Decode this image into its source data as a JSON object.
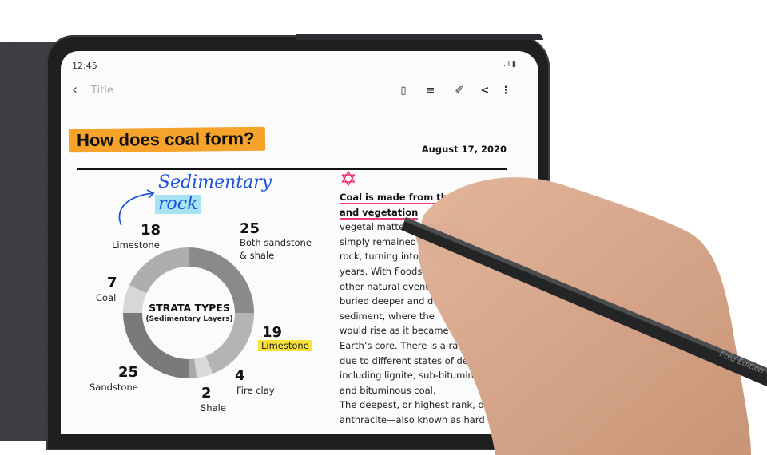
{
  "device": {
    "status_bar": {
      "time": "12:45",
      "signal_icon": "signal-icon",
      "battery_icon": "battery-icon"
    },
    "app_bar": {
      "back_icon": "chevron-left-icon",
      "title": "Title",
      "actions": [
        {
          "name": "book-view-icon",
          "glyph": "▯"
        },
        {
          "name": "note-icon",
          "glyph": "≡"
        },
        {
          "name": "attach-icon",
          "glyph": "✐"
        },
        {
          "name": "share-icon",
          "glyph": "<"
        },
        {
          "name": "more-icon",
          "glyph": "⋮"
        }
      ]
    }
  },
  "note": {
    "heading": "How does coal form?",
    "date": "August 17, 2020",
    "annotation_line1": "Sedimentary",
    "annotation_line2": "rock",
    "star_glyph": "✡",
    "body_bold_1": "Coal is made from the remai",
    "body_bold_2": "and vegetation",
    "body_lines": [
      "vegetal matte",
      "simply remained",
      "rock, turning into",
      "years. With floods,",
      "other natural event",
      "buried deeper and de",
      "sediment, where the",
      "would rise as it became",
      "Earth’s core. There is a ra",
      "due to different states of de",
      "including lignite, sub-bitumino",
      "and bituminous coal.",
      "The deepest, or highest rank, of coa",
      "anthracite—also known as hard coal o"
    ],
    "pen_label": "Fold Edition"
  },
  "chart_data": {
    "type": "pie",
    "title": "STRATA TYPES",
    "subtitle": "(Sedimentary Layers)",
    "categories": [
      "Both sandstone & shale",
      "Limestone",
      "Fire clay",
      "Shale",
      "Sandstone",
      "Coal",
      "Limestone"
    ],
    "values": [
      25,
      19,
      4,
      2,
      25,
      7,
      18
    ],
    "colors": [
      "#8a8a8a",
      "#b4b4b4",
      "#dadada",
      "#a9a9a9",
      "#7a7a7a",
      "#d7d7d7",
      "#aeaeae"
    ],
    "labels": [
      {
        "value": "18",
        "text": "Limestone"
      },
      {
        "value": "25",
        "text": "Both sandstone"
      },
      {
        "value": "",
        "text": "& shale"
      },
      {
        "value": "7",
        "text": "Coal"
      },
      {
        "value": "19",
        "text": "Limestone"
      },
      {
        "value": "25",
        "text": "Sandstone"
      },
      {
        "value": "4",
        "text": "Fire clay"
      },
      {
        "value": "2",
        "text": "Shale"
      }
    ],
    "highlight_color": "#f7e23a"
  }
}
